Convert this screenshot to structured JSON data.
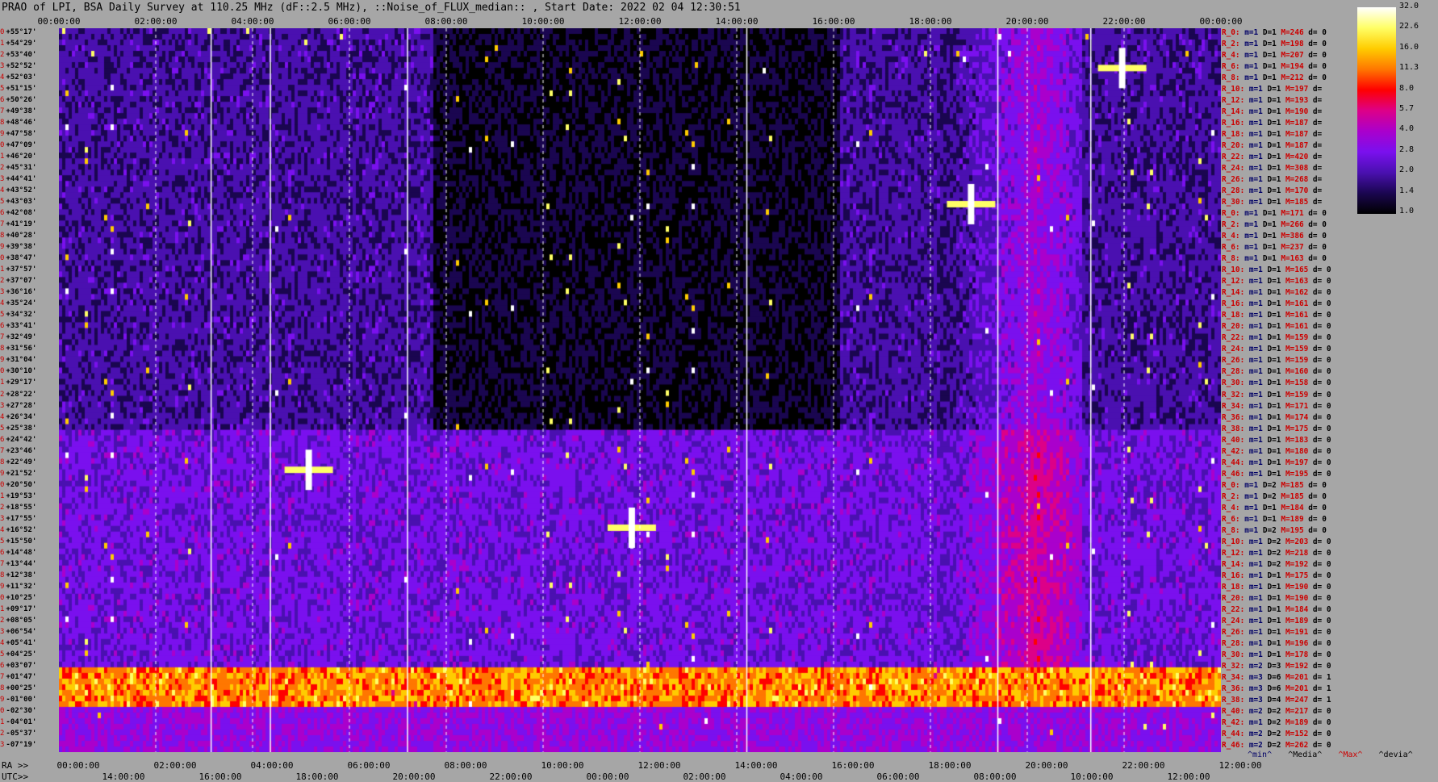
{
  "title": "PRAO of LPI, BSA Daily Survey at 110.25 MHz (dF::2.5 MHz), ::Noise_of_FLUX_median:: , Start Date: 2022 02 04 12:30:51",
  "axes": {
    "top_ticks": [
      "00:00:00",
      "02:00:00",
      "04:00:00",
      "06:00:00",
      "08:00:00",
      "10:00:00",
      "12:00:00",
      "14:00:00",
      "16:00:00",
      "18:00:00",
      "20:00:00",
      "22:00:00",
      "00:00:00"
    ],
    "ra_prefix": "RA >>",
    "ra_ticks": [
      "00:00:00",
      "02:00:00",
      "04:00:00",
      "06:00:00",
      "08:00:00",
      "10:00:00",
      "12:00:00",
      "14:00:00",
      "16:00:00",
      "18:00:00",
      "20:00:00",
      "22:00:00",
      "12:00:00"
    ],
    "utc_prefix": "UTC>>",
    "utc_ticks": [
      "14:00:00",
      "16:00:00",
      "18:00:00",
      "20:00:00",
      "22:00:00",
      "00:00:00",
      "02:00:00",
      "04:00:00",
      "06:00:00",
      "08:00:00",
      "10:00:00",
      "12:00:00"
    ]
  },
  "declinations": [
    "+55°17'",
    "+54°29'",
    "+53°40'",
    "+52°52'",
    "+52°03'",
    "+51°15'",
    "+50°26'",
    "+49°38'",
    "+48°46'",
    "+47°58'",
    "+47°09'",
    "+46°20'",
    "+45°31'",
    "+44°41'",
    "+43°52'",
    "+43°03'",
    "+42°08'",
    "+41°19'",
    "+40°28'",
    "+39°38'",
    "+38°47'",
    "+37°57'",
    "+37°07'",
    "+36°16'",
    "+35°24'",
    "+34°32'",
    "+33°41'",
    "+32°49'",
    "+31°56'",
    "+31°04'",
    "+30°10'",
    "+29°17'",
    "+28°22'",
    "+27°28'",
    "+26°34'",
    "+25°38'",
    "+24°42'",
    "+23°46'",
    "+22°49'",
    "+21°52'",
    "+20°50'",
    "+19°53'",
    "+18°55'",
    "+17°55'",
    "+16°52'",
    "+15°50'",
    "+14°48'",
    "+13°44'",
    "+12°38'",
    "+11°32'",
    "+10°25'",
    "+09°17'",
    "+08°05'",
    "+06°54'",
    "+05°41'",
    "+04°25'",
    "+03°07'",
    "+01°47'",
    "+00°25'",
    "-01°00'",
    "-02°30'",
    "-04°01'",
    "-05°37'",
    "-07°19'"
  ],
  "stats": [
    {
      "r": "R_0:",
      "m": "m=1",
      "d": "D=1",
      "M": "M=246",
      "dv": "d= 0"
    },
    {
      "r": "R_2:",
      "m": "m=1",
      "d": "D=1",
      "M": "M=198",
      "dv": "d= 0"
    },
    {
      "r": "R_4:",
      "m": "m=1",
      "d": "D=1",
      "M": "M=207",
      "dv": "d= 0"
    },
    {
      "r": "R_6:",
      "m": "m=1",
      "d": "D=1",
      "M": "M=194",
      "dv": "d= 0"
    },
    {
      "r": "R_8:",
      "m": "m=1",
      "d": "D=1",
      "M": "M=212",
      "dv": "d= 0"
    },
    {
      "r": "R_10:",
      "m": "m=1",
      "d": "D=1",
      "M": "M=197",
      "dv": "d="
    },
    {
      "r": "R_12:",
      "m": "m=1",
      "d": "D=1",
      "M": "M=193",
      "dv": "d="
    },
    {
      "r": "R_14:",
      "m": "m=1",
      "d": "D=1",
      "M": "M=190",
      "dv": "d="
    },
    {
      "r": "R_16:",
      "m": "m=1",
      "d": "D=1",
      "M": "M=187",
      "dv": "d="
    },
    {
      "r": "R_18:",
      "m": "m=1",
      "d": "D=1",
      "M": "M=187",
      "dv": "d="
    },
    {
      "r": "R_20:",
      "m": "m=1",
      "d": "D=1",
      "M": "M=187",
      "dv": "d="
    },
    {
      "r": "R_22:",
      "m": "m=1",
      "d": "D=1",
      "M": "M=420",
      "dv": "d="
    },
    {
      "r": "R_24:",
      "m": "m=1",
      "d": "D=1",
      "M": "M=308",
      "dv": "d="
    },
    {
      "r": "R_26:",
      "m": "m=1",
      "d": "D=1",
      "M": "M=268",
      "dv": "d="
    },
    {
      "r": "R_28:",
      "m": "m=1",
      "d": "D=1",
      "M": "M=170",
      "dv": "d="
    },
    {
      "r": "R_30:",
      "m": "m=1",
      "d": "D=1",
      "M": "M=185",
      "dv": "d="
    },
    {
      "r": "R_0:",
      "m": "m=1",
      "d": "D=1",
      "M": "M=171",
      "dv": "d= 0"
    },
    {
      "r": "R_2:",
      "m": "m=1",
      "d": "D=1",
      "M": "M=266",
      "dv": "d= 0"
    },
    {
      "r": "R_4:",
      "m": "m=1",
      "d": "D=1",
      "M": "M=386",
      "dv": "d= 0"
    },
    {
      "r": "R_6:",
      "m": "m=1",
      "d": "D=1",
      "M": "M=237",
      "dv": "d= 0"
    },
    {
      "r": "R_8:",
      "m": "m=1",
      "d": "D=1",
      "M": "M=163",
      "dv": "d= 0"
    },
    {
      "r": "R_10:",
      "m": "m=1",
      "d": "D=1",
      "M": "M=165",
      "dv": "d= 0"
    },
    {
      "r": "R_12:",
      "m": "m=1",
      "d": "D=1",
      "M": "M=163",
      "dv": "d= 0"
    },
    {
      "r": "R_14:",
      "m": "m=1",
      "d": "D=1",
      "M": "M=162",
      "dv": "d= 0"
    },
    {
      "r": "R_16:",
      "m": "m=1",
      "d": "D=1",
      "M": "M=161",
      "dv": "d= 0"
    },
    {
      "r": "R_18:",
      "m": "m=1",
      "d": "D=1",
      "M": "M=161",
      "dv": "d= 0"
    },
    {
      "r": "R_20:",
      "m": "m=1",
      "d": "D=1",
      "M": "M=161",
      "dv": "d= 0"
    },
    {
      "r": "R_22:",
      "m": "m=1",
      "d": "D=1",
      "M": "M=159",
      "dv": "d= 0"
    },
    {
      "r": "R_24:",
      "m": "m=1",
      "d": "D=1",
      "M": "M=159",
      "dv": "d= 0"
    },
    {
      "r": "R_26:",
      "m": "m=1",
      "d": "D=1",
      "M": "M=159",
      "dv": "d= 0"
    },
    {
      "r": "R_28:",
      "m": "m=1",
      "d": "D=1",
      "M": "M=160",
      "dv": "d= 0"
    },
    {
      "r": "R_30:",
      "m": "m=1",
      "d": "D=1",
      "M": "M=158",
      "dv": "d= 0"
    },
    {
      "r": "R_32:",
      "m": "m=1",
      "d": "D=1",
      "M": "M=159",
      "dv": "d= 0"
    },
    {
      "r": "R_34:",
      "m": "m=1",
      "d": "D=1",
      "M": "M=171",
      "dv": "d= 0"
    },
    {
      "r": "R_36:",
      "m": "m=1",
      "d": "D=1",
      "M": "M=174",
      "dv": "d= 0"
    },
    {
      "r": "R_38:",
      "m": "m=1",
      "d": "D=1",
      "M": "M=175",
      "dv": "d= 0"
    },
    {
      "r": "R_40:",
      "m": "m=1",
      "d": "D=1",
      "M": "M=183",
      "dv": "d= 0"
    },
    {
      "r": "R_42:",
      "m": "m=1",
      "d": "D=1",
      "M": "M=180",
      "dv": "d= 0"
    },
    {
      "r": "R_44:",
      "m": "m=1",
      "d": "D=1",
      "M": "M=197",
      "dv": "d= 0"
    },
    {
      "r": "R_46:",
      "m": "m=1",
      "d": "D=1",
      "M": "M=195",
      "dv": "d= 0"
    },
    {
      "r": "R_0:",
      "m": "m=1",
      "d": "D=2",
      "M": "M=185",
      "dv": "d= 0"
    },
    {
      "r": "R_2:",
      "m": "m=1",
      "d": "D=2",
      "M": "M=185",
      "dv": "d= 0"
    },
    {
      "r": "R_4:",
      "m": "m=1",
      "d": "D=1",
      "M": "M=184",
      "dv": "d= 0"
    },
    {
      "r": "R_6:",
      "m": "m=1",
      "d": "D=1",
      "M": "M=189",
      "dv": "d= 0"
    },
    {
      "r": "R_8:",
      "m": "m=1",
      "d": "D=2",
      "M": "M=195",
      "dv": "d= 0"
    },
    {
      "r": "R_10:",
      "m": "m=1",
      "d": "D=2",
      "M": "M=203",
      "dv": "d= 0"
    },
    {
      "r": "R_12:",
      "m": "m=1",
      "d": "D=2",
      "M": "M=218",
      "dv": "d= 0"
    },
    {
      "r": "R_14:",
      "m": "m=1",
      "d": "D=2",
      "M": "M=192",
      "dv": "d= 0"
    },
    {
      "r": "R_16:",
      "m": "m=1",
      "d": "D=1",
      "M": "M=175",
      "dv": "d= 0"
    },
    {
      "r": "R_18:",
      "m": "m=1",
      "d": "D=1",
      "M": "M=190",
      "dv": "d= 0"
    },
    {
      "r": "R_20:",
      "m": "m=1",
      "d": "D=1",
      "M": "M=190",
      "dv": "d= 0"
    },
    {
      "r": "R_22:",
      "m": "m=1",
      "d": "D=1",
      "M": "M=184",
      "dv": "d= 0"
    },
    {
      "r": "R_24:",
      "m": "m=1",
      "d": "D=1",
      "M": "M=189",
      "dv": "d= 0"
    },
    {
      "r": "R_26:",
      "m": "m=1",
      "d": "D=1",
      "M": "M=191",
      "dv": "d= 0"
    },
    {
      "r": "R_28:",
      "m": "m=1",
      "d": "D=1",
      "M": "M=196",
      "dv": "d= 0"
    },
    {
      "r": "R_30:",
      "m": "m=1",
      "d": "D=1",
      "M": "M=178",
      "dv": "d= 0"
    },
    {
      "r": "R_32:",
      "m": "m=2",
      "d": "D=3",
      "M": "M=192",
      "dv": "d= 0"
    },
    {
      "r": "R_34:",
      "m": "m=3",
      "d": "D=6",
      "M": "M=201",
      "dv": "d= 1"
    },
    {
      "r": "R_36:",
      "m": "m=3",
      "d": "D=6",
      "M": "M=201",
      "dv": "d= 1"
    },
    {
      "r": "R_38:",
      "m": "m=3",
      "d": "D=4",
      "M": "M=247",
      "dv": "d= 1"
    },
    {
      "r": "R_40:",
      "m": "m=2",
      "d": "D=2",
      "M": "M=217",
      "dv": "d= 0"
    },
    {
      "r": "R_42:",
      "m": "m=1",
      "d": "D=2",
      "M": "M=189",
      "dv": "d= 0"
    },
    {
      "r": "R_44:",
      "m": "m=2",
      "d": "D=2",
      "M": "M=152",
      "dv": "d= 0"
    },
    {
      "r": "R_46:",
      "m": "m=2",
      "d": "D=2",
      "M": "M=262",
      "dv": "d= 0"
    }
  ],
  "colorbar": {
    "ticks": [
      "32.0",
      "22.6",
      "16.0",
      "11.3",
      "8.0",
      "5.7",
      "4.0",
      "2.8",
      "2.0",
      "1.4",
      "1.0"
    ],
    "colors": [
      "#ffffff",
      "#ffff66",
      "#ffcc00",
      "#ff7700",
      "#ff0000",
      "#dd0088",
      "#aa00cc",
      "#7a10ee",
      "#4a10b0",
      "#1a0650",
      "#000000"
    ]
  },
  "legend": {
    "min": "^min^",
    "median": "^Media^",
    "max": "^Max^",
    "devia": "^devia^"
  },
  "chart_data": {
    "type": "heatmap",
    "title": "PRAO of LPI, BSA Daily Survey at 110.25 MHz (dF::2.5 MHz), ::Noise_of_FLUX_median:: , Start Date: 2022 02 04 12:30:51",
    "x_ticks_top": [
      "00:00:00",
      "02:00:00",
      "04:00:00",
      "06:00:00",
      "08:00:00",
      "10:00:00",
      "12:00:00",
      "14:00:00",
      "16:00:00",
      "18:00:00",
      "20:00:00",
      "22:00:00",
      "00:00:00"
    ],
    "y_range": [
      "+55°17'",
      "-07°19'"
    ],
    "y_row_count": 64,
    "colorbar_range": [
      1.0,
      32.0
    ],
    "features": [
      {
        "label": "strong interference band",
        "dec_range": [
          "+03°07'",
          "-01°00'"
        ],
        "level": "8.0-32.0"
      },
      {
        "label": "bright source",
        "ra": "20:00:00",
        "dec": "+41°19'",
        "level": "32.0"
      },
      {
        "label": "bright source",
        "ra": "12:00:00",
        "dec": "+12°38'",
        "level": "22.6"
      }
    ]
  }
}
